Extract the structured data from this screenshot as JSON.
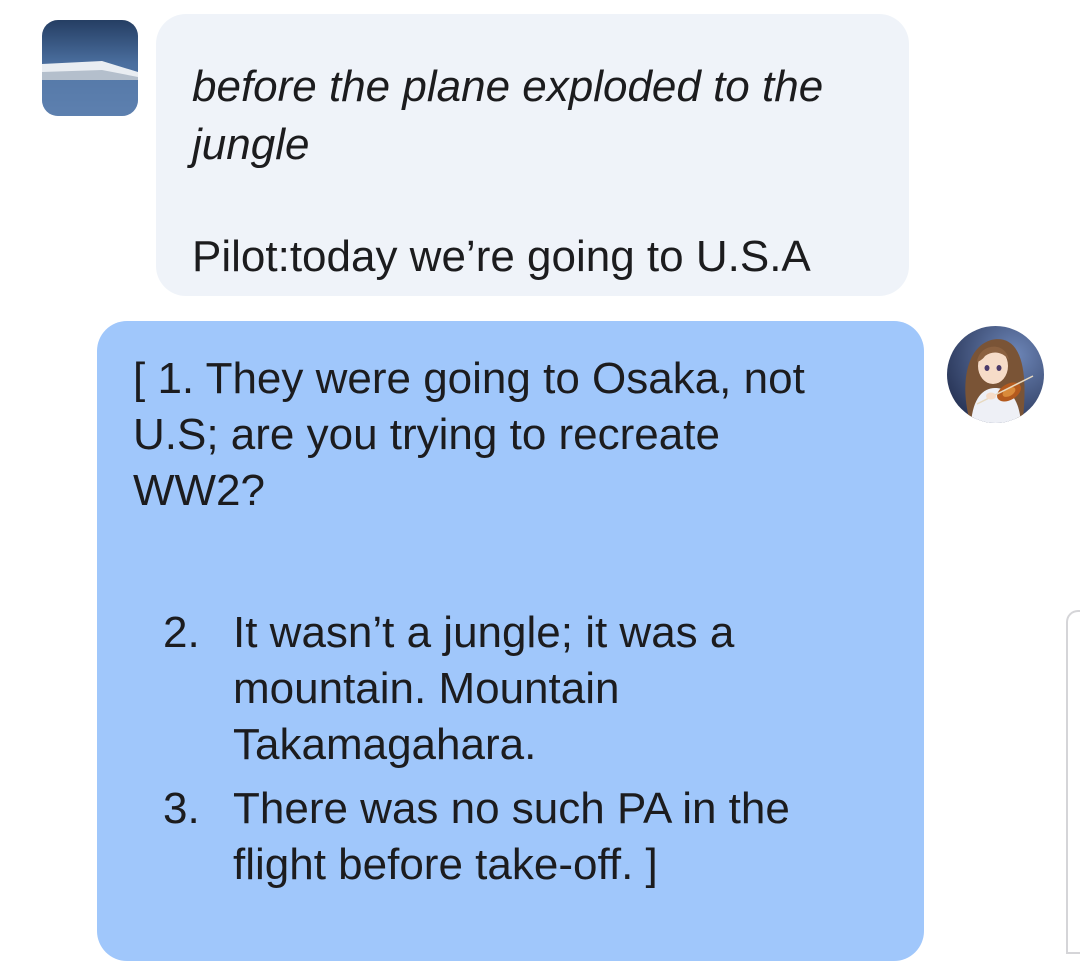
{
  "conversation": {
    "user_message": {
      "narration": "before the plane exploded to the jungle",
      "dialogue": "Pilot:today we’re going to U.S.A"
    },
    "bot_message": {
      "intro": "[ 1. They were going to Osaka, not U.S; are you trying to recreate WW2?",
      "items": [
        {
          "number": "2.",
          "text": "It wasn’t a jungle; it was a mountain. Mountain Takamagahara."
        },
        {
          "number": "3.",
          "text": "There was no such PA in the flight before take-off. ]"
        }
      ]
    }
  },
  "colors": {
    "user_bubble": "#eff3f9",
    "bot_bubble": "#a0c7fb",
    "background": "#ffffff",
    "text": "#1c1c1e"
  },
  "icons": {
    "user_avatar": "airplane-photo-avatar",
    "bot_avatar": "anime-violinist-avatar"
  }
}
